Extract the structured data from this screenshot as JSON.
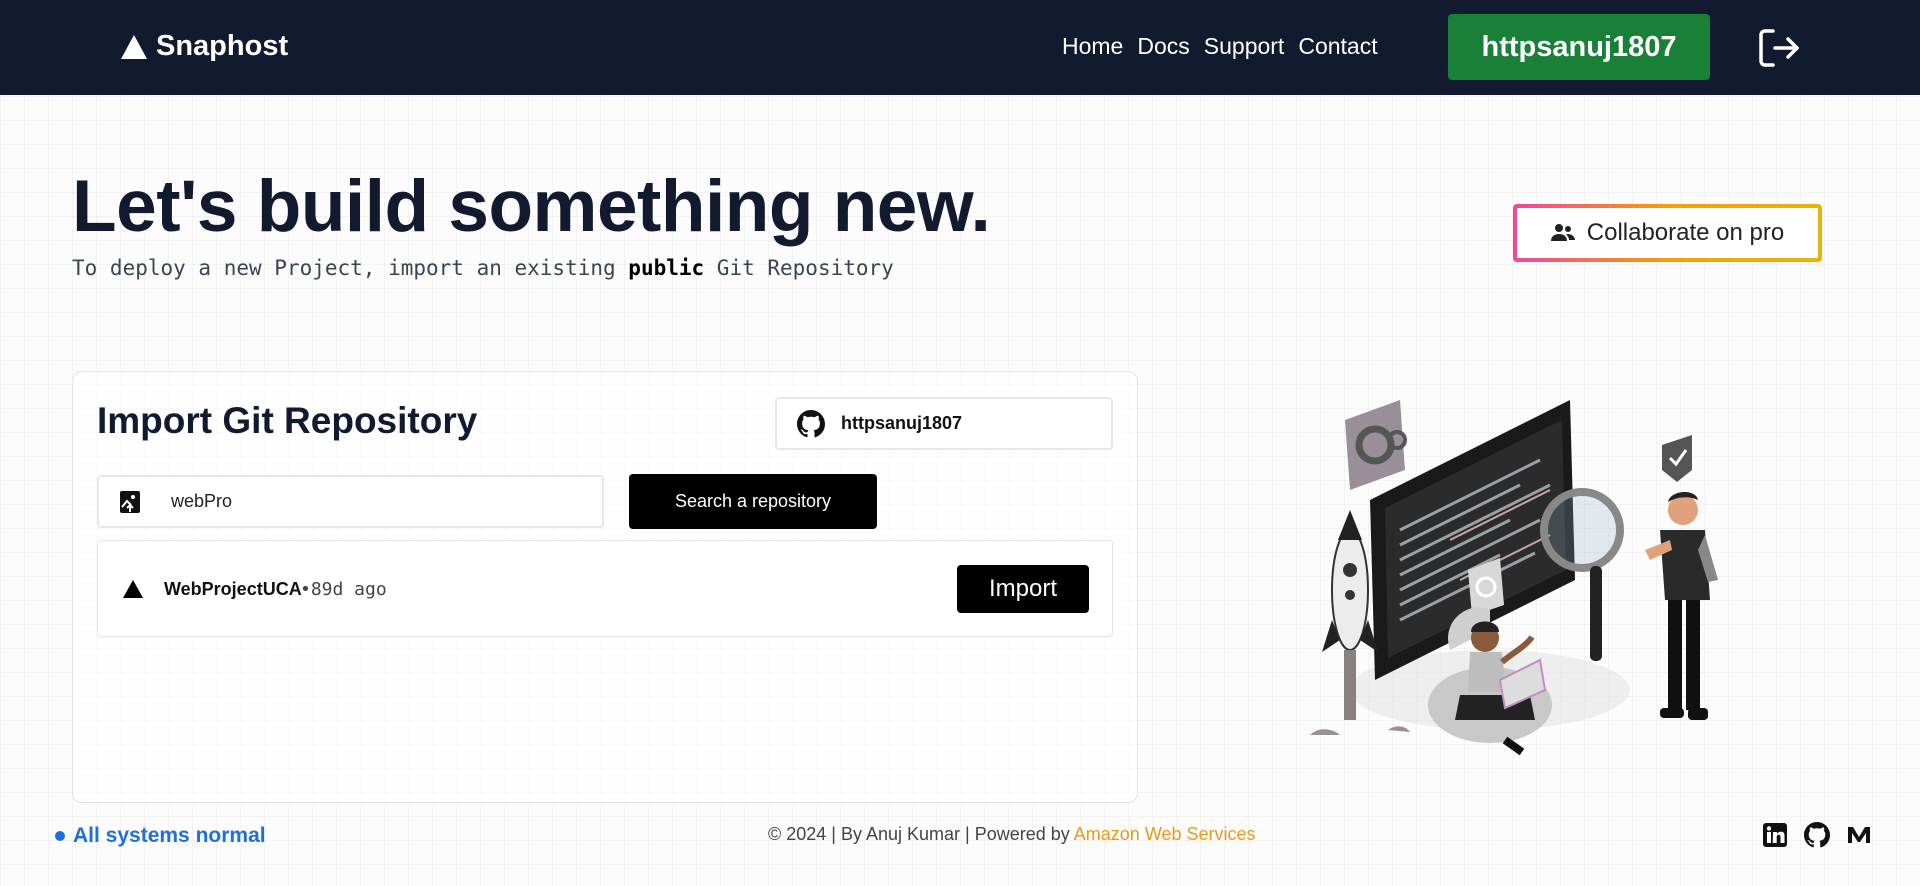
{
  "navbar": {
    "brand": "Snaphost",
    "links": [
      "Home",
      "Docs",
      "Support",
      "Contact"
    ],
    "user_button": "httpsanuj1807",
    "logout_icon": "logout-icon",
    "background": "#111a2e",
    "user_button_color": "#198038"
  },
  "hero": {
    "title": "Let's build something new.",
    "subtitle_prefix": "To deploy a new Project, import an existing ",
    "subtitle_bold": "public",
    "subtitle_suffix": " Git Repository",
    "collab_label": "Collaborate on pro",
    "collab_icon": "users-icon"
  },
  "import_card": {
    "title": "Import Git Repository",
    "github_user": "httpsanuj1807",
    "search_value": "webPro",
    "search_button": "Search a repository",
    "results": [
      {
        "name": "WebProjectUCA",
        "age": "•89d ago",
        "action": "Import"
      }
    ]
  },
  "footer": {
    "status": "All systems normal",
    "credit_prefix": "© 2024 | By Anuj Kumar | Powered by ",
    "credit_link": "Amazon Web Services",
    "socials": [
      "linkedin-icon",
      "github-icon",
      "medium-icon"
    ],
    "status_color": "#1e6fd9",
    "link_color": "#e59a1a"
  }
}
